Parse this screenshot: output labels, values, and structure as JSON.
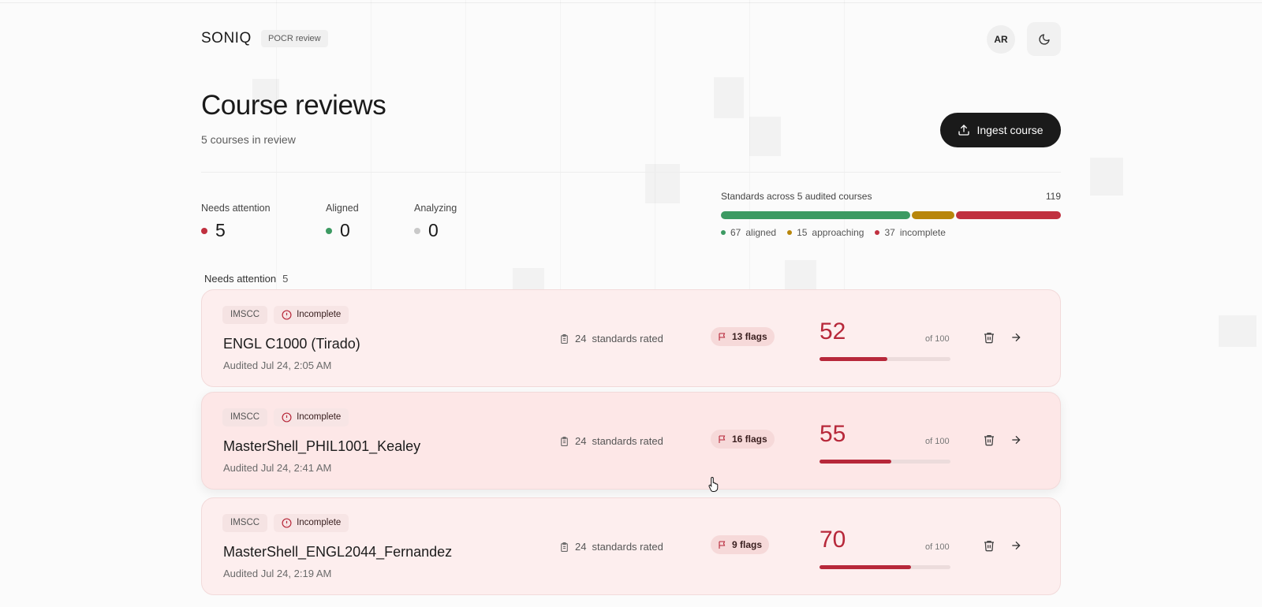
{
  "header": {
    "brand": "SONIQ",
    "tag": "POCR review",
    "avatar_initials": "AR",
    "theme_toggle_icon": "moon-icon"
  },
  "page": {
    "title": "Course reviews",
    "subtitle": "5 courses in review",
    "ingest_label": "Ingest course",
    "ingest_icon": "upload-icon"
  },
  "stats": [
    {
      "label": "Needs attention",
      "value": "5",
      "color": "#c0303f"
    },
    {
      "label": "Aligned",
      "value": "0",
      "color": "#3c9a62"
    },
    {
      "label": "Analyzing",
      "value": "0",
      "color": "#c9c9c9"
    }
  ],
  "standards": {
    "title": "Standards across 5 audited courses",
    "total": "119",
    "segments": [
      {
        "count": "67",
        "label": "aligned",
        "value": 67,
        "color": "#3c9a62"
      },
      {
        "count": "15",
        "label": "approaching",
        "value": 15,
        "color": "#b8860b"
      },
      {
        "count": "37",
        "label": "incomplete",
        "value": 37,
        "color": "#c0303f"
      }
    ]
  },
  "section": {
    "label": "Needs attention",
    "count": "5"
  },
  "courses": [
    {
      "format": "IMSCC",
      "status": "Incomplete",
      "title": "ENGL C1000 (Tirado)",
      "audited": "Audited Jul 24, 2:05 AM",
      "rated_count": "24",
      "rated_label": "standards rated",
      "flags": "13 flags",
      "score": "52",
      "score_value": 52,
      "score_of": "of 100"
    },
    {
      "format": "IMSCC",
      "status": "Incomplete",
      "title": "MasterShell_PHIL1001_Kealey",
      "audited": "Audited Jul 24, 2:41 AM",
      "rated_count": "24",
      "rated_label": "standards rated",
      "flags": "16 flags",
      "score": "55",
      "score_value": 55,
      "score_of": "of 100"
    },
    {
      "format": "IMSCC",
      "status": "Incomplete",
      "title": "MasterShell_ENGL2044_Fernandez",
      "audited": "Audited Jul 24, 2:19 AM",
      "rated_count": "24",
      "rated_label": "standards rated",
      "flags": "9 flags",
      "score": "70",
      "score_value": 70,
      "score_of": "of 100"
    }
  ],
  "colors": {
    "accent": "#b7283a",
    "card_bg": "#fdeeee",
    "button_dark": "#1a1a1a"
  }
}
